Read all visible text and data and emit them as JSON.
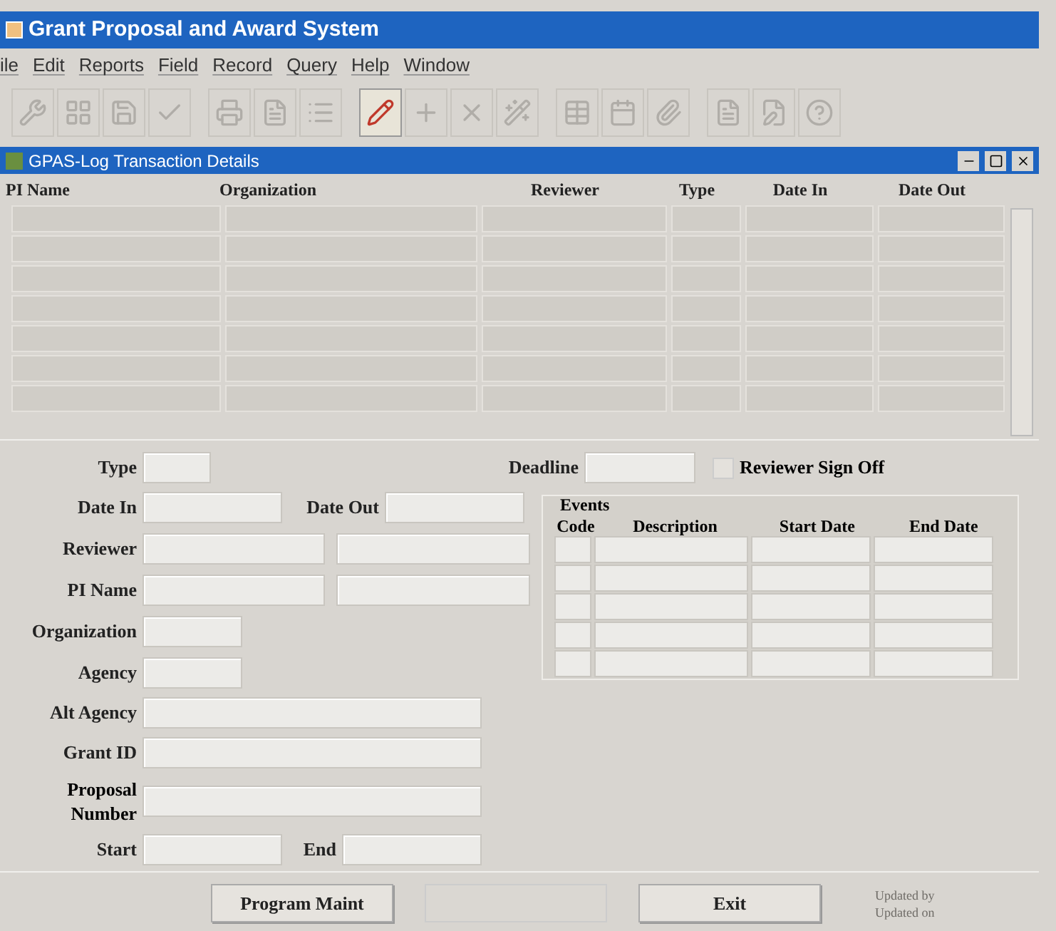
{
  "app": {
    "title": "Grant Proposal and Award System"
  },
  "menu": [
    "ile",
    "Edit",
    "Reports",
    "Field",
    "Record",
    "Query",
    "Help",
    "Window"
  ],
  "toolbar": [
    [
      {
        "kind": "wrench",
        "disabled": true
      },
      {
        "kind": "grid",
        "disabled": true
      },
      {
        "kind": "save",
        "disabled": true
      },
      {
        "kind": "check",
        "disabled": true
      }
    ],
    [
      {
        "kind": "print",
        "disabled": true
      },
      {
        "kind": "doc",
        "disabled": true
      },
      {
        "kind": "list",
        "disabled": true
      }
    ],
    [
      {
        "kind": "pencil",
        "disabled": false
      },
      {
        "kind": "plus",
        "disabled": true
      },
      {
        "kind": "cross",
        "disabled": true
      },
      {
        "kind": "wand",
        "disabled": true
      }
    ],
    [
      {
        "kind": "table",
        "disabled": true
      },
      {
        "kind": "calendar",
        "disabled": true
      },
      {
        "kind": "clip",
        "disabled": true
      }
    ],
    [
      {
        "kind": "doc",
        "disabled": true
      },
      {
        "kind": "edit",
        "disabled": true
      },
      {
        "kind": "help",
        "disabled": true
      }
    ]
  ],
  "window": {
    "title": "GPAS-Log Transaction Details"
  },
  "table": {
    "columns": [
      "PI Name",
      "Organization",
      "Reviewer",
      "Type",
      "Date In",
      "Date Out"
    ]
  },
  "form": {
    "type_label": "Type",
    "deadline_label": "Deadline",
    "sign_off": {
      "label": "Reviewer Sign Off",
      "checked": false
    },
    "date_in_label": "Date In",
    "date_out_label": "Date Out",
    "reviewer_label": "Reviewer",
    "pi_name_label": "PI Name",
    "organization_label": "Organization",
    "agency_label": "Agency",
    "alt_agency_label": "Alt Agency",
    "grant_id_label": "Grant ID",
    "proposal_label": "Proposal Number",
    "start_label": "Start",
    "end_label": "End"
  },
  "events": {
    "title": "Events",
    "columns": [
      "Code",
      "Description",
      "Start Date",
      "End Date"
    ]
  },
  "buttons": [
    {
      "label": "Program Maint",
      "disabled": false
    },
    {
      "disabled": true
    },
    {
      "label": "Exit",
      "disabled": false
    }
  ],
  "updated": [
    "Updated by",
    "Updated on"
  ]
}
